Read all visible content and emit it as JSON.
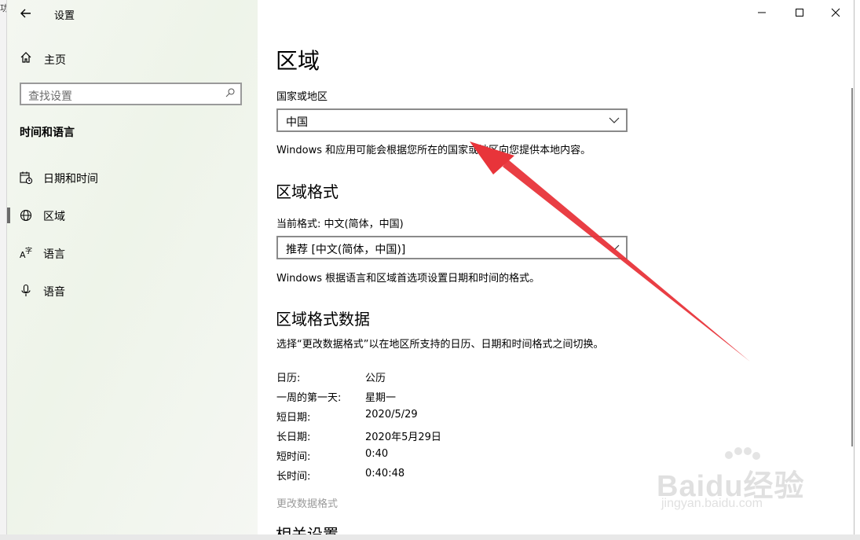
{
  "window": {
    "title": "设置",
    "back_icon": "arrow-left-icon",
    "controls": {
      "minimize": "—",
      "maximize": "☐",
      "close": "✕"
    }
  },
  "sidebar": {
    "home_label": "主页",
    "search_placeholder": "查找设置",
    "section_title": "时间和语言",
    "items": [
      {
        "label": "日期和时间",
        "icon": "calendar-clock-icon"
      },
      {
        "label": "区域",
        "icon": "globe-icon",
        "selected": true
      },
      {
        "label": "语言",
        "icon": "language-icon"
      },
      {
        "label": "语音",
        "icon": "microphone-icon"
      }
    ]
  },
  "main": {
    "title": "区域",
    "country_label": "国家或地区",
    "country_value": "中国",
    "country_desc": "Windows 和应用可能会根据您所在的国家或地区向您提供本地内容。",
    "format_heading": "区域格式",
    "current_format_label": "当前格式: 中文(简体，中国)",
    "format_value": "推荐 [中文(简体，中国)]",
    "format_desc": "Windows 根据语言和区域首选项设置日期和时间的格式。",
    "data_heading": "区域格式数据",
    "data_desc": "选择“更改数据格式”以在地区所支持的日历、日期和时间格式之间切换。",
    "data_rows": [
      {
        "key": "日历:",
        "value": "公历"
      },
      {
        "key": "一周的第一天:",
        "value": "星期一"
      },
      {
        "key": "短日期:",
        "value": "2020/5/29"
      },
      {
        "key": "长日期:",
        "value": "2020年5月29日"
      },
      {
        "key": "短时间:",
        "value": "0:40"
      },
      {
        "key": "长时间:",
        "value": "0:40:48"
      }
    ],
    "change_format_link": "更改数据格式",
    "related_heading": "相关设置"
  },
  "annotation": {
    "color": "#e8343a"
  },
  "watermark": {
    "main": "Baidu经验",
    "sub": "jingyan.baidu.com"
  },
  "colors": {
    "sidebar_bg": "#eef4e9",
    "accent_gray": "#6b6b6b",
    "disabled_text": "#9a9a9a"
  }
}
